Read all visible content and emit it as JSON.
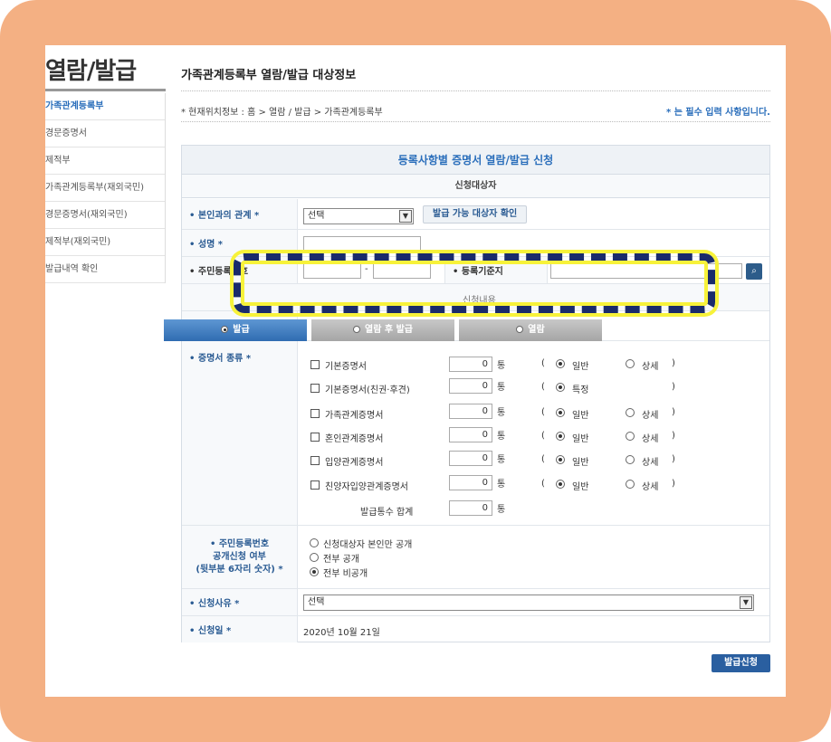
{
  "sidebar": {
    "title": "열람/발급",
    "items": [
      {
        "label": "가족관계등록부",
        "active": true
      },
      {
        "label": "경문증명서"
      },
      {
        "label": "제적부"
      },
      {
        "label": "가족관계등록부(재외국민)"
      },
      {
        "label": "경문증명서(재외국민)"
      },
      {
        "label": "제적부(재외국민)"
      },
      {
        "label": "발급내역 확인"
      }
    ]
  },
  "header": {
    "title": "가족관계등록부 열람/발급 대상정보",
    "location": "* 현재위치정보 : 홈 > 열람 / 발급 > 가족관계등록부",
    "required_note": "* 는 필수 입력 사항입니다."
  },
  "form": {
    "title": "등록사항별 증명서 열람/발급 신청",
    "subtitle": "신청대상자",
    "relation_label": "• 본인과의 관계 *",
    "relation_value": "선택",
    "check_button": "발급 가능 대상자 확인",
    "name_label": "• 성명 *",
    "rrn_label": "• 주민등록번호",
    "rrn_dash": "-",
    "reg_base_label": "• 등록기준지",
    "content_label": "신청내용",
    "tabs": [
      {
        "label": "발급",
        "active": true
      },
      {
        "label": "열람 후 발급",
        "active": false
      },
      {
        "label": "열람",
        "active": false
      }
    ],
    "cert_type_label": "• 증명서 종류 *",
    "certs": [
      {
        "name": "기본증명서",
        "count": "0",
        "unit": "통",
        "opt1": "일반",
        "opt2": "상세"
      },
      {
        "name": "기본증명서(친권·후견)",
        "count": "0",
        "unit": "통",
        "opt1": "특정",
        "opt2": ""
      },
      {
        "name": "가족관계증명서",
        "count": "0",
        "unit": "통",
        "opt1": "일반",
        "opt2": "상세"
      },
      {
        "name": "혼인관계증명서",
        "count": "0",
        "unit": "통",
        "opt1": "일반",
        "opt2": "상세"
      },
      {
        "name": "입양관계증명서",
        "count": "0",
        "unit": "통",
        "opt1": "일반",
        "opt2": "상세"
      },
      {
        "name": "친양자입양관계증명서",
        "count": "0",
        "unit": "통",
        "opt1": "일반",
        "opt2": "상세"
      }
    ],
    "paren_open": "(",
    "paren_close": ")",
    "total_label": "발급통수 합계",
    "total_value": "0",
    "total_unit": "통",
    "rrn_disclosure_label_1": "• 주민등록번호",
    "rrn_disclosure_label_2": "공개신청 여부",
    "rrn_disclosure_label_3": "(뒷부분 6자리 숫자) *",
    "disclosure_options": [
      "신청대상자 본인만 공개",
      "전부 공개",
      "전부 비공개"
    ],
    "reason_label": "• 신청사유 *",
    "reason_value": "선택",
    "date_label": "• 신청일 *",
    "date_value": "2020년 10월 21일",
    "submit": "발급신청"
  },
  "colors": {
    "accent": "#2a6ebb",
    "frame": "#f4b083",
    "highlight_dash": "#1a2b6b",
    "highlight_glow": "#f7f23a"
  }
}
